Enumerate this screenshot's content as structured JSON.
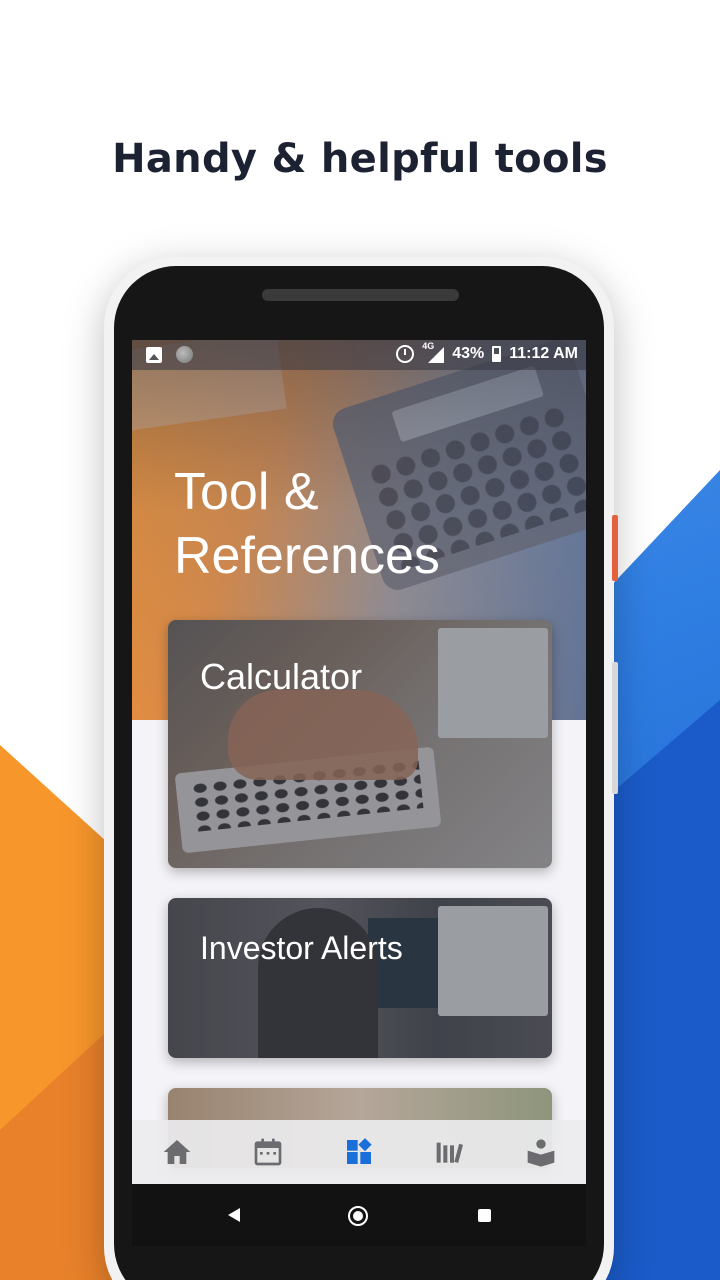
{
  "headline": "Handy & helpful tools",
  "status_bar": {
    "network": "4G",
    "battery": "43%",
    "time": "11:12 AM",
    "icons": [
      "image-icon",
      "circle-icon",
      "alarm-icon",
      "signal-icon",
      "battery-icon"
    ]
  },
  "page": {
    "title_line1": "Tool &",
    "title_line2": "References"
  },
  "cards": [
    {
      "title": "Calculator"
    },
    {
      "title": "Investor Alerts"
    },
    {
      "title": ""
    }
  ],
  "bottom_nav": {
    "items": [
      {
        "icon": "home-icon",
        "active": false
      },
      {
        "icon": "calendar-icon",
        "active": false
      },
      {
        "icon": "dashboard-icon",
        "active": true
      },
      {
        "icon": "library-icon",
        "active": false
      },
      {
        "icon": "reader-icon",
        "active": false
      }
    ]
  },
  "colors": {
    "accent_active": "#1a6fd8",
    "nav_inactive": "#6b6b70",
    "orange": "#f2922e",
    "blue": "#2f7ee2",
    "headline": "#1d2233"
  }
}
